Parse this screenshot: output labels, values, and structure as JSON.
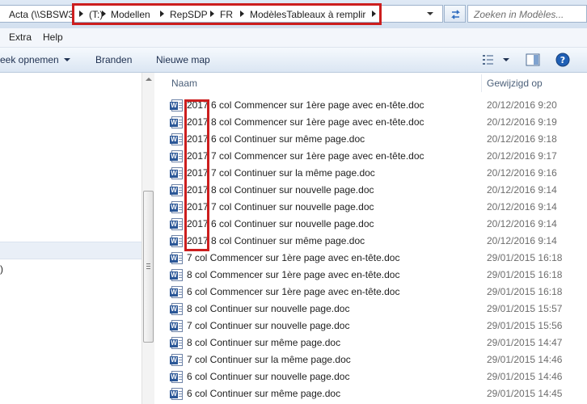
{
  "address_bar": {
    "crumbs": [
      "Acta (\\\\SBSW3",
      "(T:)",
      "Modellen",
      "RepSDP",
      "FR",
      "ModèlesTableaux à remplir"
    ],
    "search_placeholder": "Zoeken in Modèles..."
  },
  "menu": [
    "Extra",
    "Help"
  ],
  "commands": {
    "burn": "eek opnemen",
    "burn_icon": "chevron-down-icon",
    "share": "Branden",
    "new_folder": "Nieuwe map"
  },
  "nav_pane": {
    "item_fragment": ")"
  },
  "columns": {
    "name": "Naam",
    "modified": "Gewijzigd op"
  },
  "files": [
    {
      "name": "2017 6 col Commencer sur 1ère page avec en-tête.doc",
      "modified": "20/12/2016 9:20"
    },
    {
      "name": "2017 8 col Commencer sur 1ère page avec en-tête.doc",
      "modified": "20/12/2016 9:19"
    },
    {
      "name": "2017 6 col Continuer sur même page.doc",
      "modified": "20/12/2016 9:18"
    },
    {
      "name": "2017 7 col Commencer sur 1ère page avec en-tête.doc",
      "modified": "20/12/2016 9:17"
    },
    {
      "name": "2017 7 col Continuer sur la même page.doc",
      "modified": "20/12/2016 9:16"
    },
    {
      "name": "2017 8 col Continuer sur nouvelle page.doc",
      "modified": "20/12/2016 9:14"
    },
    {
      "name": "2017 7 col Continuer sur nouvelle page.doc",
      "modified": "20/12/2016 9:14"
    },
    {
      "name": "2017 6 col Continuer sur nouvelle page.doc",
      "modified": "20/12/2016 9:14"
    },
    {
      "name": "2017 8 col Continuer sur même page.doc",
      "modified": "20/12/2016 9:14"
    },
    {
      "name": "7 col Commencer sur 1ère page avec en-tête.doc",
      "modified": "29/01/2015 16:18"
    },
    {
      "name": "8 col Commencer sur 1ère page avec en-tête.doc",
      "modified": "29/01/2015 16:18"
    },
    {
      "name": "6 col Commencer sur 1ère page avec en-tête.doc",
      "modified": "29/01/2015 16:18"
    },
    {
      "name": "8 col Continuer sur nouvelle page.doc",
      "modified": "29/01/2015 15:57"
    },
    {
      "name": "7 col Continuer sur nouvelle page.doc",
      "modified": "29/01/2015 15:56"
    },
    {
      "name": "8 col Continuer sur même page.doc",
      "modified": "29/01/2015 14:47"
    },
    {
      "name": "7 col Continuer sur la même page.doc",
      "modified": "29/01/2015 14:46"
    },
    {
      "name": "6 col Continuer sur nouvelle page.doc",
      "modified": "29/01/2015 14:46"
    },
    {
      "name": "6 col Continuer sur même page.doc",
      "modified": "29/01/2015 14:45"
    }
  ],
  "colors": {
    "highlight_outline": "#cc1e1e",
    "chrome": "#dbe6f3",
    "help_accent": "#1f5fb5"
  },
  "icons": [
    "refresh-icon",
    "view-options-icon",
    "preview-pane-icon",
    "help-icon",
    "word-document-icon"
  ]
}
